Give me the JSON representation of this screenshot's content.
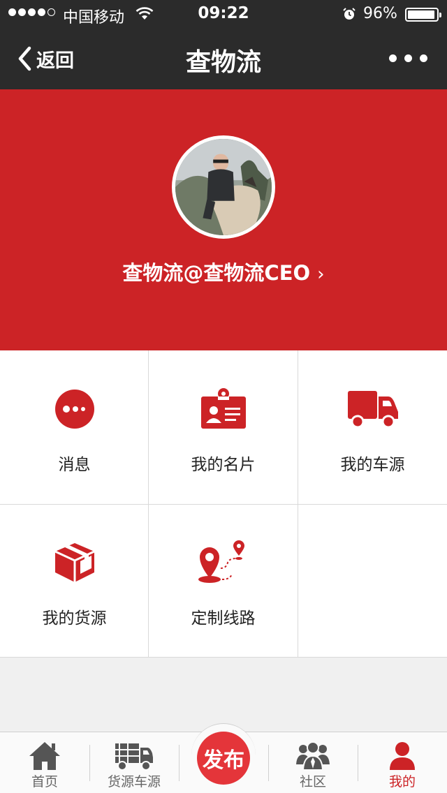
{
  "status_bar": {
    "carrier": "中国移动",
    "time": "09:22",
    "battery_percent": "96%",
    "battery_level": 0.96,
    "signal_bars": 4,
    "icons": [
      "signal-icon",
      "wifi-icon",
      "alarm-icon",
      "battery-icon"
    ]
  },
  "nav": {
    "back_label": "返回",
    "title": "查物流",
    "icons": [
      "chevron-left-icon",
      "more-icon"
    ]
  },
  "profile": {
    "name": "查物流@查物流CEO",
    "chevron": "›"
  },
  "grid": {
    "items": [
      {
        "label": "消息",
        "icon": "chat-bubble-icon"
      },
      {
        "label": "我的名片",
        "icon": "business-card-icon"
      },
      {
        "label": "我的车源",
        "icon": "truck-icon"
      },
      {
        "label": "我的货源",
        "icon": "package-box-icon"
      },
      {
        "label": "定制线路",
        "icon": "route-pin-icon"
      }
    ]
  },
  "tab_bar": {
    "tabs": [
      {
        "label": "首页",
        "icon": "home-icon"
      },
      {
        "label": "货源车源",
        "icon": "cargo-truck-icon"
      },
      {
        "label": "社区",
        "icon": "community-icon"
      },
      {
        "label": "我的",
        "icon": "user-icon",
        "active": true
      }
    ],
    "publish_label": "发布"
  },
  "colors": {
    "brand_red": "#cc2326",
    "publish_red": "#e4353a",
    "dark_bar": "#2b2b2b",
    "tab_icon_gray": "#555555"
  }
}
